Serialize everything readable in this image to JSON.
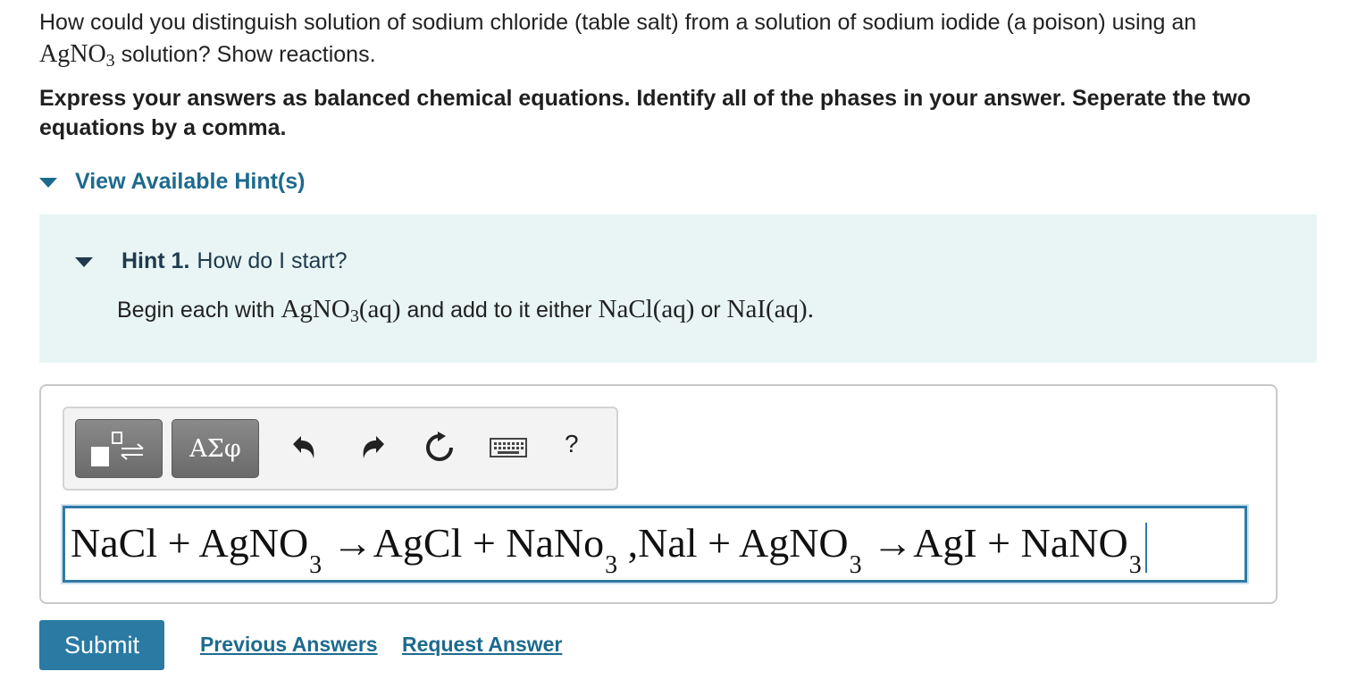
{
  "question": {
    "text_before": "How could you distinguish solution of sodium chloride (table salt) from a solution of sodium iodide (a poison) using an",
    "formula_base": "AgNO",
    "formula_sub": "3",
    "text_after": "solution? Show reactions."
  },
  "instructions": "Express your answers as balanced chemical equations. Identify all of the phases in your answer. Seperate the two equations by a comma.",
  "hints_toggle": {
    "label": "View Available Hint(s)"
  },
  "hint": {
    "number": "Hint 1.",
    "title": "How do I start?",
    "body_1": "Begin each with",
    "formula_1_base": "AgNO",
    "formula_1_sub": "3",
    "formula_1_phase": "(aq)",
    "body_2": "and add to it either",
    "formula_2": "NaCl(aq)",
    "body_3": "or",
    "formula_3": "NaI(aq)",
    "end": "."
  },
  "toolbar": {
    "template_button": "templates-icon",
    "greek_label": "ΑΣφ",
    "undo": "undo-icon",
    "redo": "redo-icon",
    "reset": "reset-icon",
    "keyboard": "keyboard-icon",
    "help_label": "?"
  },
  "answer": {
    "p1": "NaCl + AgNO",
    "p1s": "3",
    "p2": " →AgCl + NaNo",
    "p2s": "3",
    "p3": " ,Nal + AgNO",
    "p3s": "3",
    "p4": " →AgI + NaNO",
    "p4s": "3"
  },
  "actions": {
    "submit_label": "Submit",
    "previous_answers_label": "Previous Answers",
    "request_answer_label": "Request Answer"
  },
  "colors": {
    "link": "#1d6a8e",
    "submit_bg": "#2a7aa3",
    "hint_bg": "#e8f5f4",
    "input_border": "#2f7aa6"
  }
}
